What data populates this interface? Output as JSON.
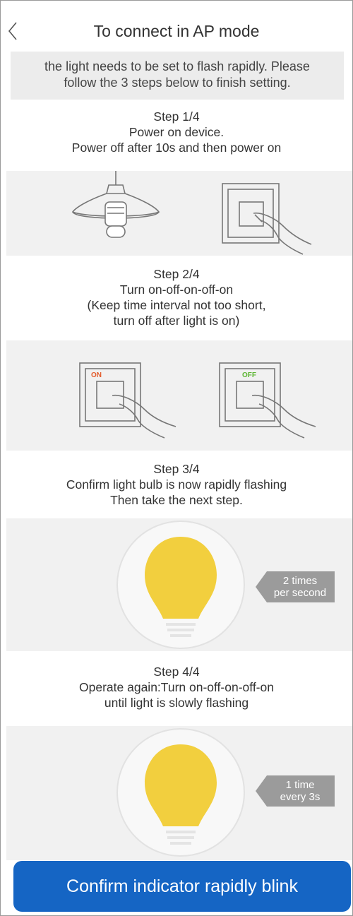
{
  "header": {
    "title": "To connect in AP mode"
  },
  "notice": {
    "lines": [
      "the light needs to be set to flash rapidly. Please",
      "follow the 3 steps below to finish setting."
    ]
  },
  "steps": [
    {
      "title": "Step 1/4",
      "lines": [
        "Power on device.",
        "Power off after 10s and then power on"
      ]
    },
    {
      "title": "Step 2/4",
      "lines": [
        "Turn on-off-on-off-on",
        "(Keep time interval not too short,",
        "turn off after light is on)"
      ],
      "switch_labels": [
        "ON",
        "OFF"
      ]
    },
    {
      "title": "Step 3/4",
      "lines": [
        "Confirm light bulb is now rapidly flashing",
        "Then take the next step."
      ],
      "callout": [
        "2 times",
        "per second"
      ]
    },
    {
      "title": "Step 4/4",
      "lines": [
        "Operate again:Turn on-off-on-off-on",
        "until light is slowly flashing"
      ],
      "callout": [
        "1 time",
        "every 3s"
      ]
    }
  ],
  "confirm_button": {
    "label": "Confirm indicator rapidly blink"
  },
  "colors": {
    "accent": "#1565c4",
    "bulb": "#f2cf3e",
    "switch_on": "#e35b2b",
    "switch_off": "#5cb531",
    "callout": "#9b9b9b"
  },
  "icons": [
    "back-chevron-icon",
    "pendant-lamp-icon",
    "hand-switch-icon",
    "light-bulb-icon",
    "callout-arrow-icon"
  ]
}
